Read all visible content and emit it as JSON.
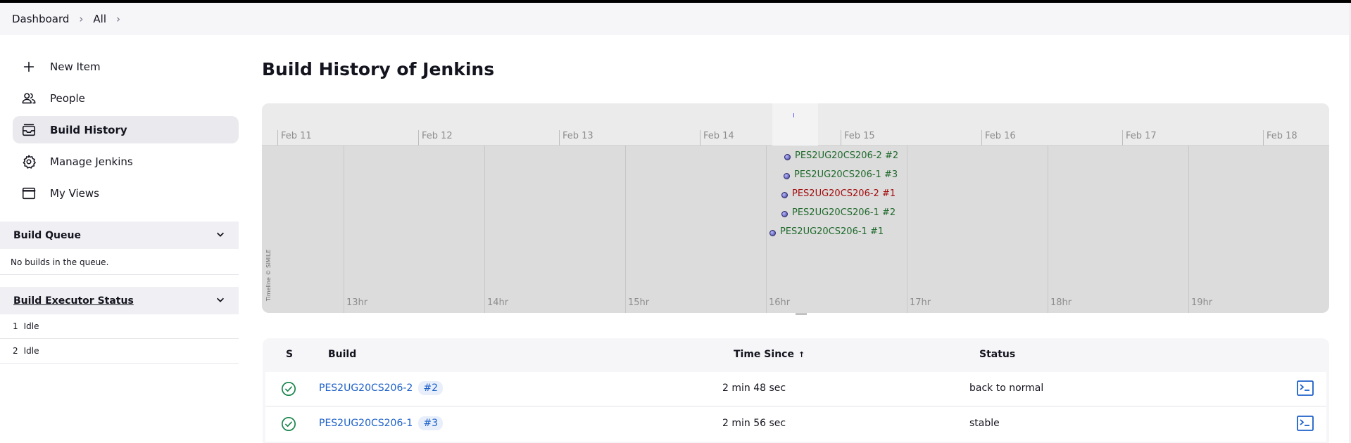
{
  "breadcrumbs": [
    {
      "label": "Dashboard"
    },
    {
      "label": "All"
    }
  ],
  "sidebar": {
    "items": [
      {
        "label": "New Item",
        "icon": "plus-icon"
      },
      {
        "label": "People",
        "icon": "people-icon"
      },
      {
        "label": "Build History",
        "icon": "build-history-icon",
        "active": true
      },
      {
        "label": "Manage Jenkins",
        "icon": "gear-icon"
      },
      {
        "label": "My Views",
        "icon": "window-icon"
      }
    ]
  },
  "build_queue": {
    "title": "Build Queue",
    "empty_text": "No builds in the queue."
  },
  "executors": {
    "title": "Build Executor Status",
    "rows": [
      {
        "num": "1",
        "state": "Idle"
      },
      {
        "num": "2",
        "state": "Idle"
      }
    ]
  },
  "page": {
    "title": "Build History of Jenkins"
  },
  "timeline": {
    "days": [
      "Feb 11",
      "Feb 12",
      "Feb 13",
      "Feb 14",
      "Feb 15",
      "Feb 16",
      "Feb 17",
      "Feb 18"
    ],
    "hours": [
      "13hr",
      "14hr",
      "15hr",
      "16hr",
      "17hr",
      "18hr",
      "19hr"
    ],
    "credit": "Timeline © SIMILE",
    "events": [
      {
        "label": "PES2UG20CS206-2 #2",
        "result": "ok"
      },
      {
        "label": "PES2UG20CS206-1 #3",
        "result": "ok"
      },
      {
        "label": "PES2UG20CS206-2 #1",
        "result": "fail"
      },
      {
        "label": "PES2UG20CS206-1 #2",
        "result": "ok"
      },
      {
        "label": "PES2UG20CS206-1 #1",
        "result": "ok"
      }
    ],
    "colors": {
      "ok": "#1f6a2c",
      "fail": "#a30d0d"
    }
  },
  "table": {
    "headers": {
      "s": "S",
      "build": "Build",
      "time_since": "Time Since",
      "sort_arrow": "↑",
      "status": "Status"
    },
    "rows": [
      {
        "job": "PES2UG20CS206-2",
        "build": "#2",
        "time": "2 min 48 sec",
        "status": "back to normal"
      },
      {
        "job": "PES2UG20CS206-1",
        "build": "#3",
        "time": "2 min 56 sec",
        "status": "stable"
      }
    ]
  }
}
